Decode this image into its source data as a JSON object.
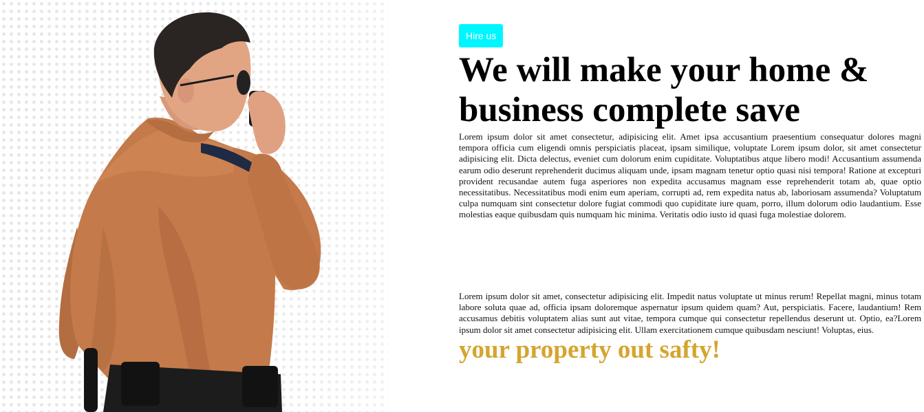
{
  "hero": {
    "image": {
      "subject": "security-guard-photo",
      "colors": {
        "shirt": "#c47a4a",
        "skin": "#e2a584",
        "hair": "#2a2522",
        "belt": "#1c1c1c",
        "epaulette": "#1f2a44"
      }
    },
    "hire_button_label": "Hire us",
    "headline": "We will make your home & business complete save",
    "paragraph_1": "Lorem ipsum dolor sit amet consectetur, adipisicing elit. Amet ipsa accusantium praesentium consequatur dolores magni tempora officia cum eligendi omnis perspiciatis placeat, ipsam similique, voluptate Lorem ipsum dolor, sit amet consectetur adipisicing elit. Dicta delectus, eveniet cum dolorum enim cupiditate. Voluptatibus atque libero modi! Accusantium assumenda earum odio deserunt reprehenderit ducimus aliquam unde, ipsam magnam tenetur optio quasi nisi tempora! Ratione at excepturi provident recusandae autem fuga asperiores non expedita accusamus magnam esse reprehenderit totam ab, quae optio necessitatibus. Necessitatibus modi enim eum aperiam, corrupti ad, rem expedita natus ab, laboriosam assumenda? Voluptatum culpa numquam sint consectetur dolore fugiat commodi quo cupiditate iure quam, porro, illum dolorum odio laudantium. Esse molestias eaque quibusdam quis numquam hic minima. Veritatis odio iusto id quasi fuga molestiae dolorem.",
    "paragraph_2": "Lorem ipsum dolor sit amet, consectetur adipisicing elit. Impedit natus voluptate ut minus rerum! Repellat magni, minus totam labore soluta quae ad, officia ipsam doloremque aspernatur ipsum quidem quam? Aut, perspiciatis. Facere, laudantium! Rem accusamus debitis voluptatem alias sunt aut vitae, tempora cumque qui consectetur repellendus deserunt ut. Optio, ea?Lorem ipsum dolor sit amet consectetur adipisicing elit. Ullam exercitationem cumque quibusdam nesciunt! Voluptas, eius.",
    "tagline": "your property out safty!"
  },
  "colors": {
    "button_bg": "#00f6ff",
    "button_text": "#ffffff",
    "headline": "#000000",
    "body_text": "#111111",
    "tagline": "#d4a52f",
    "background": "#ffffff"
  }
}
